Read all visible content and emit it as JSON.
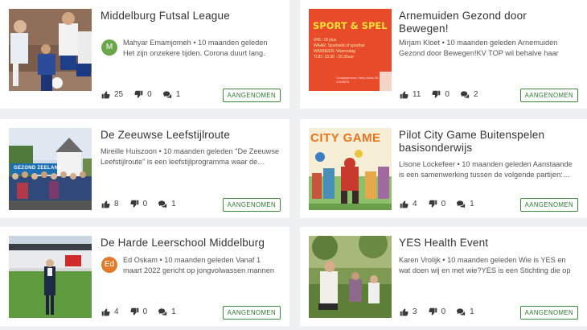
{
  "cards": [
    {
      "title": "Middelburg Futsal League",
      "author": "Mahyar Emamjomeh",
      "time": "10 maanden geleden",
      "excerpt": "Het zijn onzekere tijden. Corona duurt lang. Do…",
      "avatar": {
        "letter": "M",
        "color": "#6ba64a"
      },
      "likes": "25",
      "dislikes": "0",
      "comments": "1",
      "status": "AANGENOMEN"
    },
    {
      "title": "Arnemuiden Gezond door Bewegen!",
      "author": "Mirjam Kloet",
      "time": "10 maanden geleden",
      "excerpt": "Arnemuiden Gezond door Bewegen!KV TOP wil behalve haar leden…",
      "likes": "11",
      "dislikes": "0",
      "comments": "2",
      "status": "AANGENOMEN",
      "poster": {
        "heading": "SPORT & SPEL",
        "lines": [
          "WIE: 18 plus",
          "WAAR: Sportveld of sporthal",
          "WANNEER: Woensdag",
          "TIJD: 19.30 - 20.30uur"
        ],
        "footer": "Contactpersoon: Harry Aukes 06-12345678"
      }
    },
    {
      "title": "De Zeeuwse Leefstijlroute",
      "author": "Mireille Huiszoon",
      "time": "10 maanden geleden",
      "excerpt": "\"De Zeeuwse Leefstijlroute\" is een leefstijlprogramma waar de…",
      "likes": "8",
      "dislikes": "0",
      "comments": "1",
      "status": "AANGENOMEN",
      "banner_text": "GEZOND ZEELAND"
    },
    {
      "title": "Pilot City Game Buitenspelen basisonderwijs",
      "author": "Lisone Lockefeer",
      "time": "10 maanden geleden",
      "excerpt": "Aanstaande is een samenwerking tussen de volgende partijen:…",
      "likes": "4",
      "dislikes": "0",
      "comments": "1",
      "status": "AANGENOMEN",
      "game_title": "CITY GAME"
    },
    {
      "title": "De Harde Leerschool Middelburg",
      "author": "Ed Oskam",
      "time": "10 maanden geleden",
      "excerpt": "Vanaf 1 maart 2022 gericht op jongvolwassen mannen die…",
      "avatar": {
        "letter": "Ed",
        "color": "#e07b2c"
      },
      "likes": "4",
      "dislikes": "0",
      "comments": "1",
      "status": "AANGENOMEN"
    },
    {
      "title": "YES Health Event",
      "author": "Karen Vrolijk",
      "time": "10 maanden geleden",
      "excerpt": "Wie is YES en wat doen wij en met wie?YES is een Stichting die op divers…",
      "likes": "3",
      "dislikes": "0",
      "comments": "1",
      "status": "AANGENOMEN"
    }
  ]
}
